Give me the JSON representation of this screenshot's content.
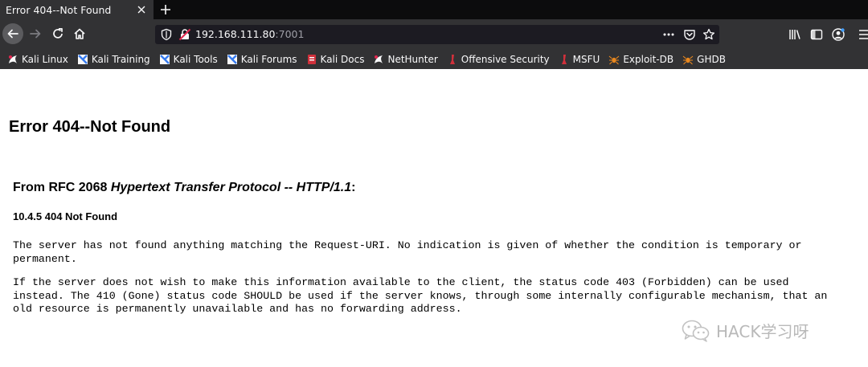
{
  "tab": {
    "title": "Error 404--Not Found"
  },
  "url": {
    "host": "192.168.111.80",
    "port": ":7001"
  },
  "bookmarks": [
    {
      "label": "Kali Linux",
      "icon": "kali-dragon-icon"
    },
    {
      "label": "Kali Training",
      "icon": "kali-training-icon"
    },
    {
      "label": "Kali Tools",
      "icon": "kali-tools-icon"
    },
    {
      "label": "Kali Forums",
      "icon": "kali-forums-icon"
    },
    {
      "label": "Kali Docs",
      "icon": "kali-docs-icon"
    },
    {
      "label": "NetHunter",
      "icon": "nethunter-icon"
    },
    {
      "label": "Offensive Security",
      "icon": "offsec-icon"
    },
    {
      "label": "MSFU",
      "icon": "msfu-icon"
    },
    {
      "label": "Exploit-DB",
      "icon": "exploitdb-spider-icon"
    },
    {
      "label": "GHDB",
      "icon": "ghdb-spider-icon"
    }
  ],
  "page": {
    "heading": "Error 404--Not Found",
    "rfc_prefix": "From RFC 2068 ",
    "rfc_title": "Hypertext Transfer Protocol -- HTTP/1.1",
    "rfc_suffix": ":",
    "section": "10.4.5 404 Not Found",
    "paragraph1": "The server has not found anything matching the Request-URI. No indication is given of whether the condition is temporary or\npermanent.",
    "paragraph2": "If the server does not wish to make this information available to the client, the status code 403 (Forbidden) can be used\ninstead. The 410 (Gone) status code SHOULD be used if the server knows, through some internally configurable mechanism, that an\nold resource is permanently unavailable and has no forwarding address."
  },
  "watermark": {
    "text": "HACK学习呀"
  },
  "colors": {
    "chrome": "#323234",
    "tabbar": "#0c0c0d",
    "urlbar": "#1c1b22",
    "text_light": "#f9f9fa",
    "port_gray": "#9e9ea6"
  }
}
